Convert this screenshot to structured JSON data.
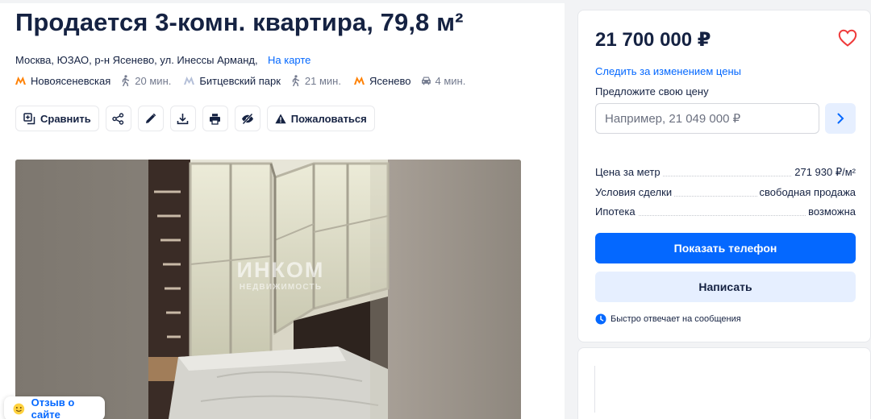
{
  "listing": {
    "title": "Продается 3-комн. квартира, 79,8 м²",
    "address": "Москва, ЮЗАО, р-н Ясенево, ул. Инессы Арманд,",
    "map_link": "На карте",
    "metro": [
      {
        "name": "Новоясеневская",
        "time": "20 мин.",
        "mode": "walk",
        "color": "#ff8103"
      },
      {
        "name": "Битцевский парк",
        "time": "21 мин.",
        "mode": "walk",
        "color": "#b4bfd8"
      },
      {
        "name": "Ясенево",
        "time": "4 мин.",
        "mode": "car",
        "color": "#ff8103"
      }
    ]
  },
  "toolbar": {
    "compare_label": "Сравнить",
    "compare_icon": "compare-icon",
    "share_icon": "share-icon",
    "edit_icon": "pencil-icon",
    "download_icon": "download-icon",
    "print_icon": "printer-icon",
    "hide_icon": "eye-off-icon",
    "complain_label": "Пожаловаться",
    "complain_icon": "warning-icon"
  },
  "photo": {
    "watermark_main": "ИНКОМ",
    "watermark_sub": "НЕДВИЖИМОСТЬ"
  },
  "feedback": {
    "label": "Отзыв о сайте",
    "icon": "smile-icon"
  },
  "sidebar": {
    "price": "21 700 000 ₽",
    "favorite_icon": "heart-icon",
    "follow_price": "Следить за изменением цены",
    "offer_label": "Предложите свою цену",
    "offer_placeholder": "Например, 21 049 000 ₽",
    "offer_submit_icon": "chevron-right-icon",
    "props": [
      {
        "key": "Цена за метр",
        "value": "271 930 ₽/м²"
      },
      {
        "key": "Условия сделки",
        "value": "свободная продажа"
      },
      {
        "key": "Ипотека",
        "value": "возможна"
      }
    ],
    "phone_button": "Показать телефон",
    "write_button": "Написать",
    "reply_note": "Быстро отвечает на сообщения",
    "reply_icon": "clock-icon"
  },
  "colors": {
    "accent": "#0468ff",
    "accent_light": "#e6efff",
    "text": "#152242",
    "muted": "#737a8e",
    "favorite": "#ef3a3a"
  }
}
